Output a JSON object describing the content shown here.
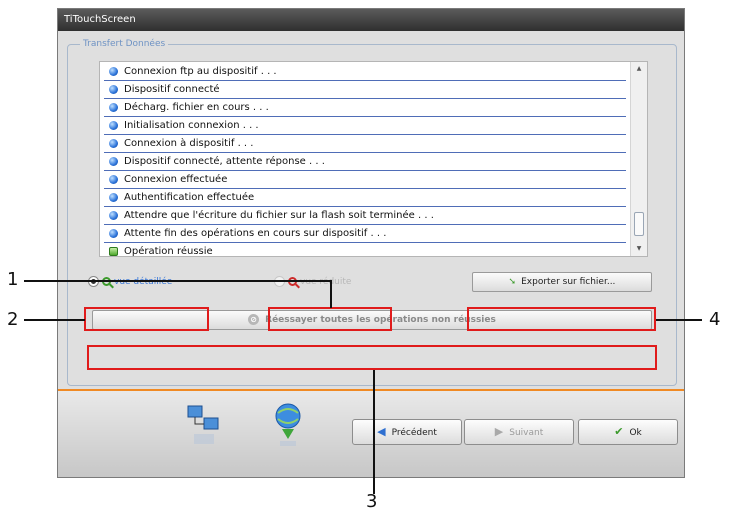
{
  "window": {
    "title": "TiTouchScreen"
  },
  "group": {
    "label": "Transfert Données"
  },
  "log": [
    {
      "text": "Connexion ftp au dispositif . . .",
      "status": "info"
    },
    {
      "text": "Dispositif connecté",
      "status": "info"
    },
    {
      "text": "Décharg. fichier en cours . . .",
      "status": "info"
    },
    {
      "text": "Initialisation connexion . . .",
      "status": "info"
    },
    {
      "text": "Connexion à dispositif . . .",
      "status": "info"
    },
    {
      "text": "Dispositif connecté, attente réponse . . .",
      "status": "info"
    },
    {
      "text": "Connexion effectuée",
      "status": "info"
    },
    {
      "text": "Authentification effectuée",
      "status": "info"
    },
    {
      "text": "Attendre que l'écriture du fichier sur la flash soit terminée . . .",
      "status": "info"
    },
    {
      "text": "Attente fin des opérations en cours sur dispositif . . .",
      "status": "info"
    },
    {
      "text": "Opération réussie",
      "status": "success"
    }
  ],
  "view": {
    "detailed": "vue détaillée",
    "reduced": "vue réduite",
    "selected": "detailed"
  },
  "buttons": {
    "export": "Exporter sur fichier...",
    "retry": "Réessayer toutes les opérations non réussies",
    "previous": "Précédent",
    "next": "Suivant",
    "ok": "Ok"
  },
  "callouts": {
    "c1": "1",
    "c2": "2",
    "c3": "3",
    "c4": "4"
  },
  "colors": {
    "accent": "#f08a24",
    "callout": "#e01b1b",
    "link": "#3a78d8"
  }
}
